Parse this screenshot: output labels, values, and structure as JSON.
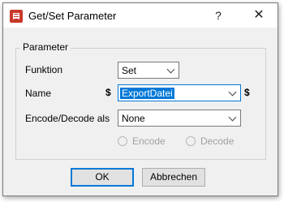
{
  "window": {
    "title": "Get/Set Parameter",
    "help_label": "?",
    "close_label": "✕",
    "icon": "app-table-icon"
  },
  "group": {
    "label": "Parameter"
  },
  "funktion": {
    "label": "Funktion",
    "value": "Set"
  },
  "name": {
    "label": "Name",
    "prefix": "$",
    "value": "ExportDatei",
    "suffix": "$"
  },
  "encode": {
    "label": "Encode/Decode als",
    "value": "None"
  },
  "radios": {
    "encode_label": "Encode",
    "decode_label": "Decode"
  },
  "buttons": {
    "ok_label": "OK",
    "cancel_label": "Abbrechen"
  },
  "colors": {
    "accent": "#0078d7",
    "icon": "#c8382a"
  }
}
